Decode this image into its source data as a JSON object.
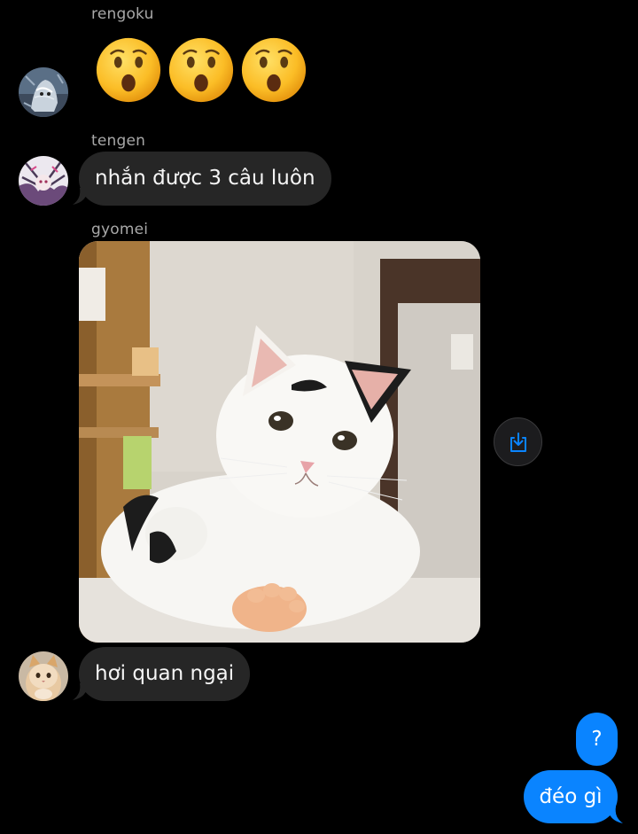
{
  "messages": [
    {
      "sender": "rengoku",
      "type": "emoji",
      "emoji": [
        "😮",
        "😮",
        "😮"
      ],
      "emoji_name": "astonished-face-emoji"
    },
    {
      "sender": "tengen",
      "type": "text",
      "text": "nhắn được 3 câu luôn"
    },
    {
      "sender": "gyomei",
      "type": "image",
      "image_desc": "cat-photo"
    },
    {
      "sender": "gyomei",
      "type": "text",
      "text": "hơi quan ngại"
    },
    {
      "sender": "me",
      "type": "text",
      "text": "?"
    },
    {
      "sender": "me",
      "type": "text",
      "text": "đéo gì"
    }
  ],
  "icons": {
    "save": "save-to-device-icon"
  },
  "colors": {
    "background": "#000000",
    "incoming_bubble": "#262626",
    "outgoing_bubble": "#0a84ff",
    "sender_name": "#a8a8a8",
    "save_icon": "#0a84ff"
  }
}
